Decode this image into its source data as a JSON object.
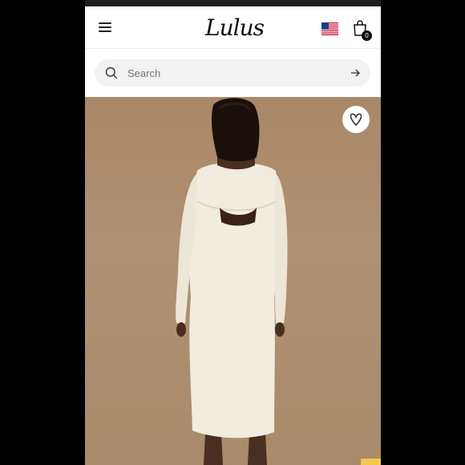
{
  "brand": {
    "logo_text": "Lulus"
  },
  "header": {
    "cart_count": "0",
    "flag_icon": "us-flag-icon",
    "bag_icon": "shopping-bag-icon",
    "menu_icon": "hamburger-menu-icon"
  },
  "search": {
    "placeholder": "Search",
    "value": ""
  },
  "product_image": {
    "favorite_icon": "heart-icon"
  },
  "colors": {
    "accent": "#111111",
    "hero_background": "#a98a6b",
    "dress": "#f1ecdf",
    "badge": "#111111"
  }
}
